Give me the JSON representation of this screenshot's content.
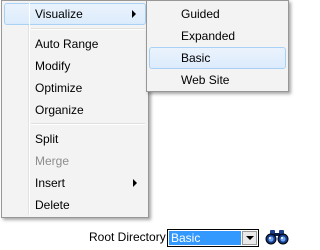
{
  "context_menu": {
    "items": [
      {
        "label": "Visualize",
        "has_submenu": true,
        "highlighted": true
      },
      {
        "label": "Auto Range"
      },
      {
        "label": "Modify"
      },
      {
        "label": "Optimize"
      },
      {
        "label": "Organize"
      },
      {
        "label": "Split"
      },
      {
        "label": "Merge",
        "disabled": true
      },
      {
        "label": "Insert",
        "has_submenu": true
      },
      {
        "label": "Delete"
      }
    ]
  },
  "visualize_submenu": {
    "items": [
      {
        "label": "Guided"
      },
      {
        "label": "Expanded"
      },
      {
        "label": "Basic",
        "highlighted": true
      },
      {
        "label": "Web Site"
      }
    ]
  },
  "root_directory": {
    "label": "Root Directory",
    "selected": "Basic"
  },
  "icons": {
    "find": "binoculars-icon",
    "submenu_arrow": "chevron-right-icon",
    "dropdown": "chevron-down-icon"
  },
  "colors": {
    "menu_background": "#f3f3f3",
    "highlight_fill": "#dcebfc",
    "highlight_border": "#a8d1f5",
    "selection": "#3399ff",
    "disabled_text": "#8d8d8d"
  }
}
